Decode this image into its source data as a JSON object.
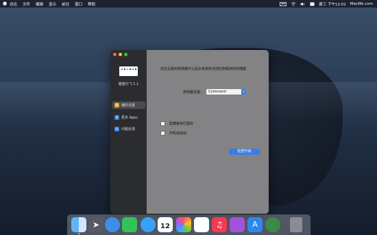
{
  "menubar": {
    "apple": "",
    "items": [
      "访达",
      "文件",
      "编辑",
      "显示",
      "前往",
      "窗口",
      "帮助"
    ],
    "datetime": "周三 下午12:01",
    "watermark": "MacWk.com"
  },
  "window": {
    "app_name": "键盘灯飞 1.1",
    "nav": [
      {
        "label": "偏好设置",
        "icon": "preferences-icon",
        "color": "#e8a11f"
      },
      {
        "label": "更多 Apps",
        "icon": "apps-icon",
        "color": "#2f7de8"
      },
      {
        "label": "问题反馈",
        "icon": "feedback-icon",
        "color": "#2f7de8"
      }
    ],
    "description": "双击设置的修饰键可以显示系统和当前应用程序的快捷键",
    "modifier_label": "修饰键设置：",
    "modifier_value": "Command",
    "checkbox_hide_menubar": "隐藏菜单栏图标",
    "checkbox_launch_login": "开机自启动",
    "upgrade_button": "检查升级"
  },
  "dock": {
    "items": [
      {
        "name": "finder-icon",
        "color": "#4aa2ef"
      },
      {
        "name": "launchpad-icon",
        "color": "#555a66"
      },
      {
        "name": "safari-icon",
        "color": "#3d8ee6"
      },
      {
        "name": "facetime-icon",
        "color": "#34c15a"
      },
      {
        "name": "messages-icon",
        "color": "#3aa0f3"
      },
      {
        "name": "calendar-icon",
        "color": "#ffffff",
        "text": "12"
      },
      {
        "name": "photos-icon",
        "color": "#ffffff"
      },
      {
        "name": "reminders-icon",
        "color": "#ffffff"
      },
      {
        "name": "music-icon",
        "color": "#f23a52"
      },
      {
        "name": "podcasts-icon",
        "color": "#a552d9"
      },
      {
        "name": "app-store-icon",
        "color": "#2f87f0"
      },
      {
        "name": "find-my-icon",
        "color": "#3a8a4a"
      },
      {
        "name": "trash-icon",
        "color": "#8a8d93"
      }
    ]
  }
}
